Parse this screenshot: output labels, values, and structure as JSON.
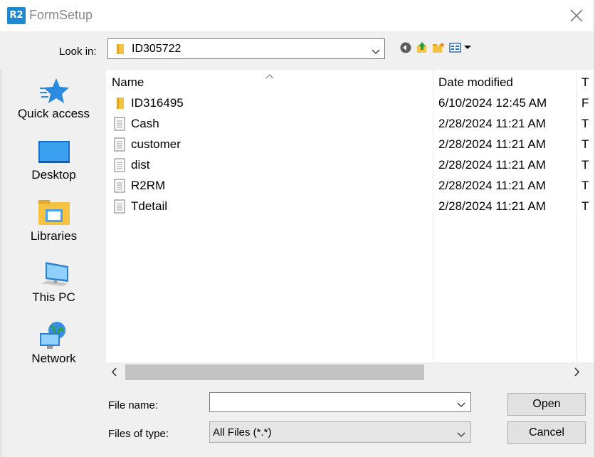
{
  "window": {
    "app_badge": "R2",
    "title": "FormSetup"
  },
  "toolbar": {
    "lookin_label": "Look in:",
    "lookin_value": "ID305722",
    "icons": [
      "back-icon",
      "up-folder-icon",
      "new-folder-icon",
      "view-menu-icon"
    ]
  },
  "places": [
    {
      "label": "Quick access",
      "icon": "star-icon"
    },
    {
      "label": "Desktop",
      "icon": "desktop-icon"
    },
    {
      "label": "Libraries",
      "icon": "libraries-icon"
    },
    {
      "label": "This PC",
      "icon": "computer-icon"
    },
    {
      "label": "Network",
      "icon": "network-icon"
    }
  ],
  "columns": {
    "name": "Name",
    "date": "Date modified",
    "type": "T"
  },
  "files": [
    {
      "name": "ID316495",
      "date": "6/10/2024 12:45 AM",
      "type": "F",
      "kind": "folder"
    },
    {
      "name": "Cash",
      "date": "2/28/2024 11:21 AM",
      "type": "T",
      "kind": "file"
    },
    {
      "name": "customer",
      "date": "2/28/2024 11:21 AM",
      "type": "T",
      "kind": "file"
    },
    {
      "name": "dist",
      "date": "2/28/2024 11:21 AM",
      "type": "T",
      "kind": "file"
    },
    {
      "name": "R2RM",
      "date": "2/28/2024 11:21 AM",
      "type": "T",
      "kind": "file"
    },
    {
      "name": "Tdetail",
      "date": "2/28/2024 11:21 AM",
      "type": "T",
      "kind": "file"
    }
  ],
  "bottom": {
    "file_name_label": "File name:",
    "file_name_value": "",
    "files_of_type_label": "Files of type:",
    "files_of_type_value": "All Files (*.*)",
    "open_label": "Open",
    "cancel_label": "Cancel"
  },
  "colors": {
    "accent": "#1e88d0",
    "folder": "#f5c242"
  }
}
